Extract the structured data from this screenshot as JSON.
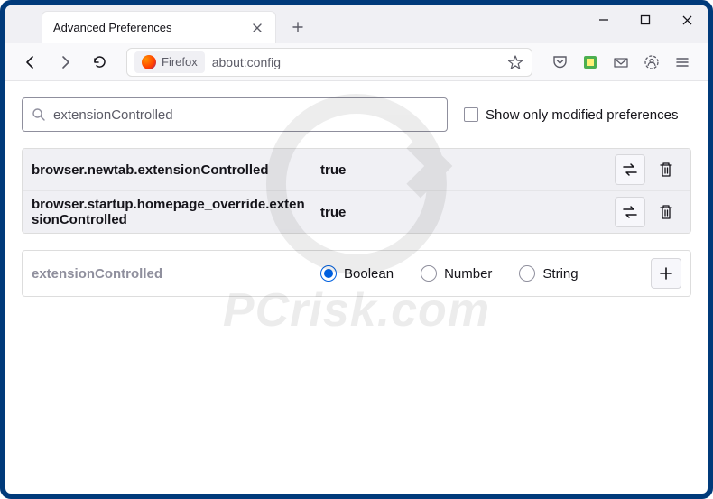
{
  "tab": {
    "title": "Advanced Preferences"
  },
  "urlbar": {
    "label": "Firefox",
    "url": "about:config"
  },
  "search": {
    "value": "extensionControlled",
    "checkbox_label": "Show only modified preferences",
    "checked": false
  },
  "prefs": [
    {
      "name": "browser.newtab.extensionControlled",
      "value": "true"
    },
    {
      "name": "browser.startup.homepage_override.extensionControlled",
      "value": "true"
    }
  ],
  "addrow": {
    "name": "extensionControlled",
    "types": [
      "Boolean",
      "Number",
      "String"
    ],
    "selected": "Boolean"
  },
  "watermark": "PCrisk.com"
}
